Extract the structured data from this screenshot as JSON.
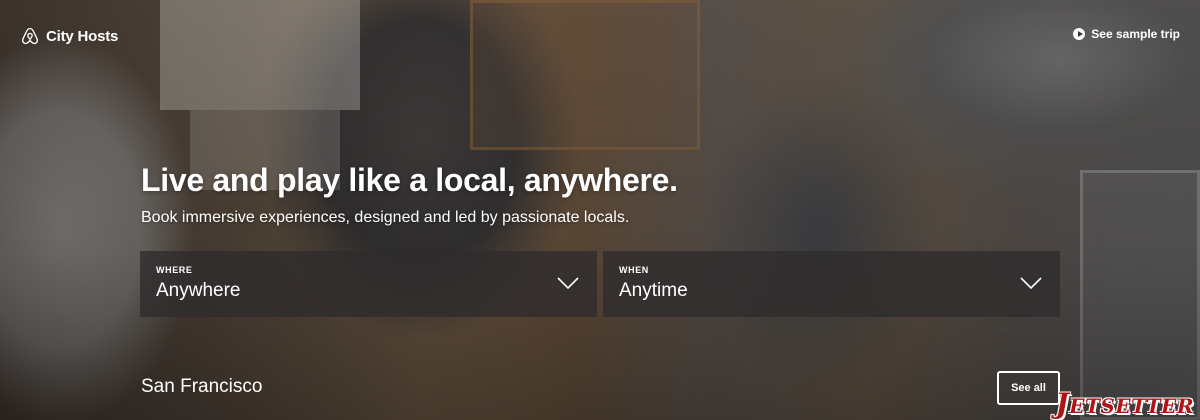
{
  "header": {
    "brand": "City Hosts",
    "sample_trip_label": "See sample trip"
  },
  "hero": {
    "headline": "Live and play like a local, anywhere.",
    "subhead": "Book immersive experiences, designed and led by passionate locals."
  },
  "search": {
    "where": {
      "label": "WHERE",
      "value": "Anywhere"
    },
    "when": {
      "label": "WHEN",
      "value": "Anytime"
    }
  },
  "city": {
    "name": "San Francisco",
    "see_all_label": "See all"
  },
  "watermark": "Jetsetter",
  "icons": {
    "logo": "airbnb-belo-icon",
    "play": "play-icon",
    "dropdown": "chevron-down-icon"
  },
  "colors": {
    "text": "#ffffff",
    "selector_bg": "#2e2c2d",
    "watermark": "#b01414"
  }
}
